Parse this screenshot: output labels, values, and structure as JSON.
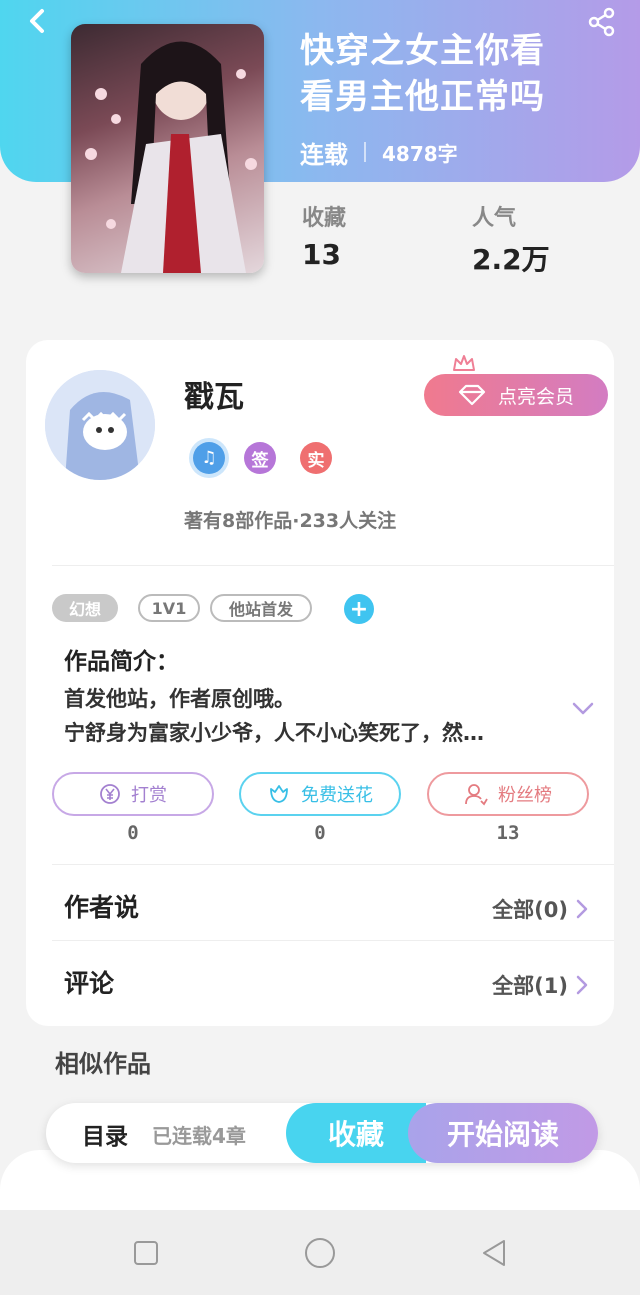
{
  "book": {
    "title_line1": "快穿之女主你看",
    "title_line2": "看男主他正常吗",
    "status": "连载",
    "word_count": "4878字",
    "favorites_label": "收藏",
    "favorites_value": "13",
    "popularity_label": "人气",
    "popularity_value": "2.2万"
  },
  "author": {
    "name": "戳瓦",
    "vip_label": "点亮会员",
    "badges": [
      "♫",
      "签",
      "实"
    ],
    "works_follow": "著有8部作品·233人关注"
  },
  "tags": [
    "幻想",
    "1V1",
    "他站首发"
  ],
  "intro": {
    "heading": "作品简介：",
    "line1": "首发他站，作者原创哦。",
    "line2": "宁舒身为富家小少爷，人不小心笑死了，然…"
  },
  "actions": [
    {
      "label": "打赏",
      "count": "0"
    },
    {
      "label": "免费送花",
      "count": "0"
    },
    {
      "label": "粉丝榜",
      "count": "13"
    }
  ],
  "author_says": {
    "label": "作者说",
    "link": "全部(0)"
  },
  "comments": {
    "label": "评论",
    "link": "全部(1)"
  },
  "similar_heading": "相似作品",
  "bottom_bar": {
    "toc": "目录",
    "chapters": "已连载4章",
    "collect": "收藏",
    "start_reading": "开始阅读"
  },
  "colors": {
    "hero_start": "#4fd6ef",
    "hero_end": "#b49be8",
    "vip_start": "#f07a8e",
    "vip_end": "#d37cc2",
    "accent_blue": "#48d4ef",
    "accent_purple": "#c19ae6"
  },
  "icons": {
    "back": "chevron-left-icon",
    "share": "share-icon",
    "expand": "chevron-down-icon",
    "row_link": "chevron-right-icon"
  }
}
